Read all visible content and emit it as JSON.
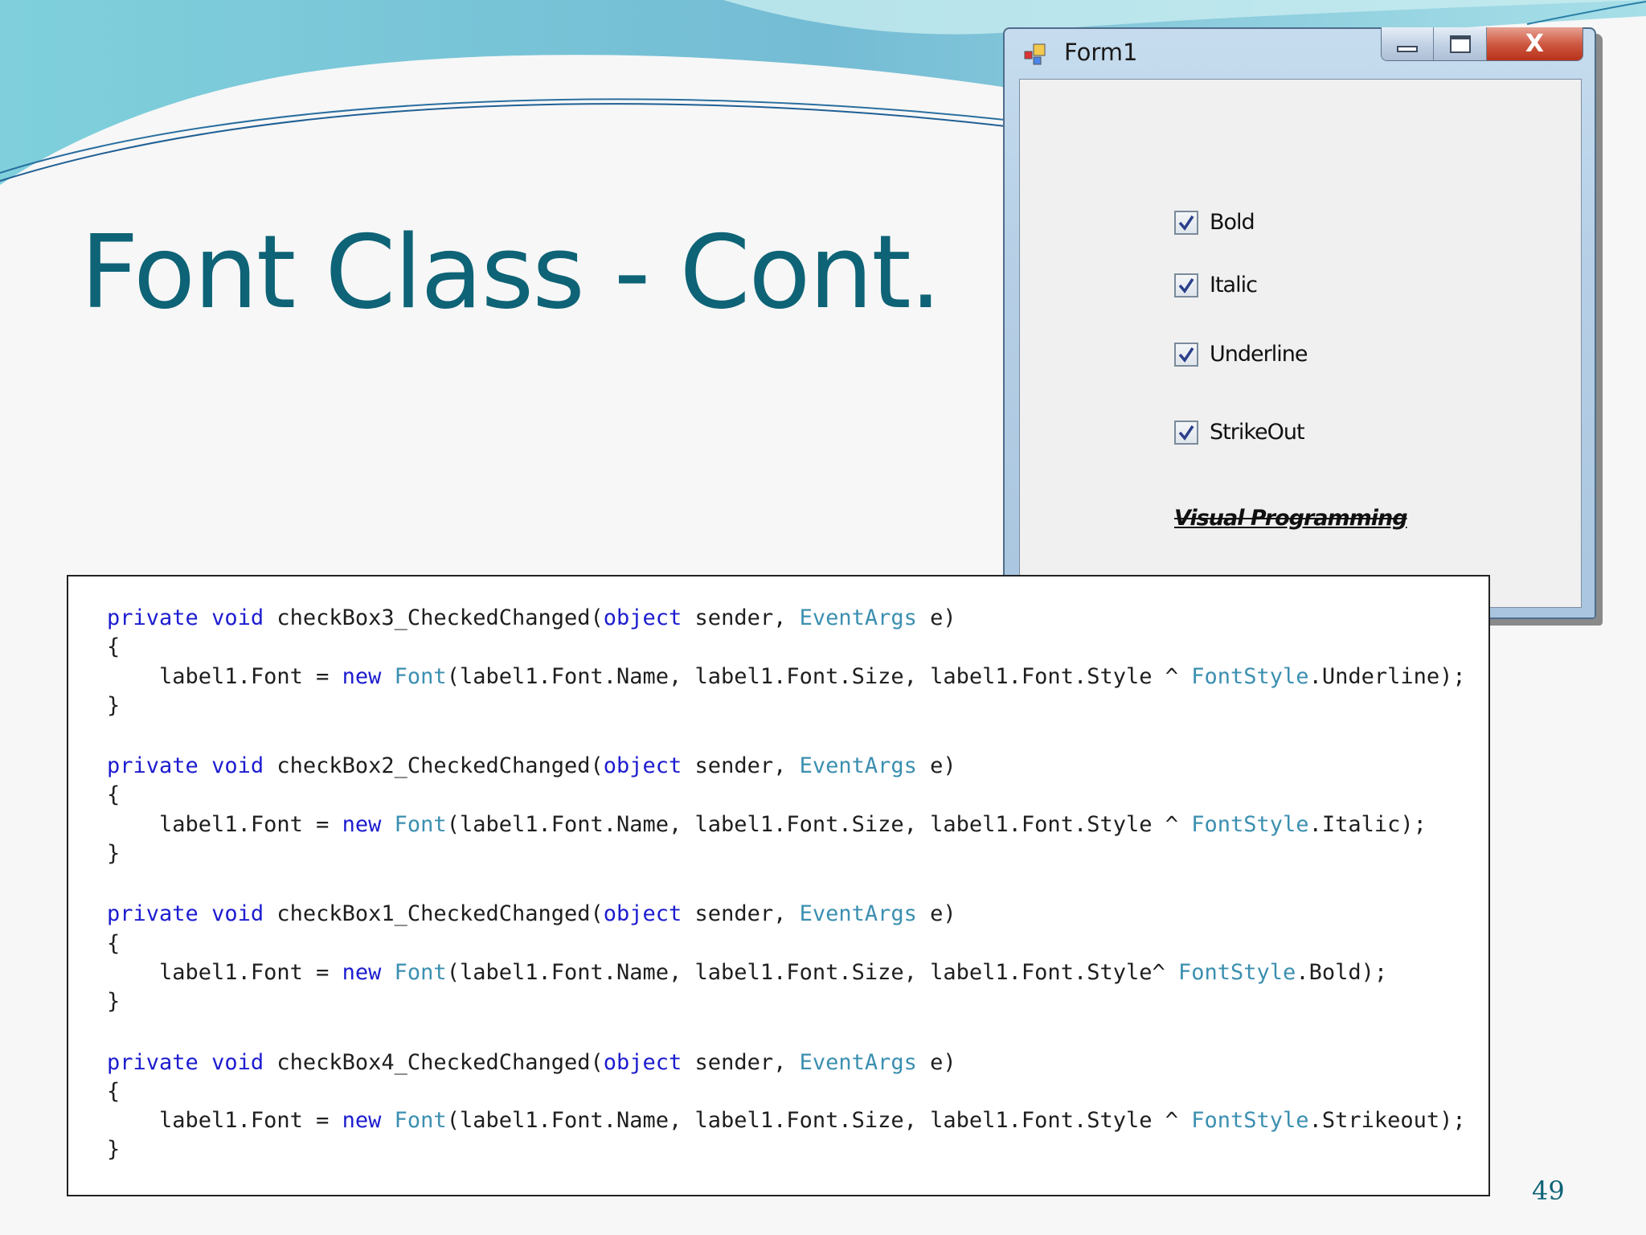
{
  "slide": {
    "title": "Font Class - Cont.",
    "page_number": "49"
  },
  "form": {
    "title": "Form1",
    "close_glyph": "X",
    "icons": [
      "app-icon",
      "minimize-icon",
      "maximize-icon",
      "close-icon",
      "checkmark-icon"
    ],
    "checkboxes": [
      {
        "label": "Bold",
        "checked": true
      },
      {
        "label": "Italic",
        "checked": true
      },
      {
        "label": "Underline",
        "checked": true
      },
      {
        "label": "StrikeOut",
        "checked": true
      }
    ],
    "demo_label": "Visual Programming"
  },
  "code": {
    "blocks": [
      {
        "method": "checkBox3_CheckedChanged",
        "header": [
          "private",
          "void",
          "checkBox3_CheckedChanged(",
          "object",
          " sender, ",
          "EventArgs",
          " e)"
        ],
        "open": "{",
        "body": [
          "label1.Font = ",
          "new",
          "Font",
          "(label1.Font.Name, label1.Font.Size, label1.Font.Style ^ ",
          "FontStyle",
          ".Underline);"
        ],
        "close": "}"
      },
      {
        "method": "checkBox2_CheckedChanged",
        "header": [
          "private",
          "void",
          "checkBox2_CheckedChanged(",
          "object",
          " sender, ",
          "EventArgs",
          " e)"
        ],
        "open": "{",
        "body": [
          "label1.Font = ",
          "new",
          "Font",
          "(label1.Font.Name, label1.Font.Size, label1.Font.Style ^ ",
          "FontStyle",
          ".Italic);"
        ],
        "close": "}"
      },
      {
        "method": "checkBox1_CheckedChanged",
        "header": [
          "private",
          "void",
          "checkBox1_CheckedChanged(",
          "object",
          " sender, ",
          "EventArgs",
          " e)"
        ],
        "open": "{",
        "body": [
          "label1.Font = ",
          "new",
          "Font",
          "(label1.Font.Name, label1.Font.Size, label1.Font.Style^ ",
          "FontStyle",
          ".Bold);"
        ],
        "close": "}"
      },
      {
        "method": "checkBox4_CheckedChanged",
        "header": [
          "private",
          "void",
          "checkBox4_CheckedChanged(",
          "object",
          " sender, ",
          "EventArgs",
          " e)"
        ],
        "open": "{",
        "body": [
          "label1.Font = ",
          "new",
          "Font",
          "(label1.Font.Name, label1.Font.Size, label1.Font.Style ^ ",
          "FontStyle",
          ".Strikeout);"
        ],
        "close": "}"
      }
    ]
  },
  "colors": {
    "title": "#0e6376",
    "keyword": "#1c1ccf",
    "type": "#3b8fb0",
    "wave_light": "#8fd3de",
    "wave_dark": "#2a7fa6"
  }
}
